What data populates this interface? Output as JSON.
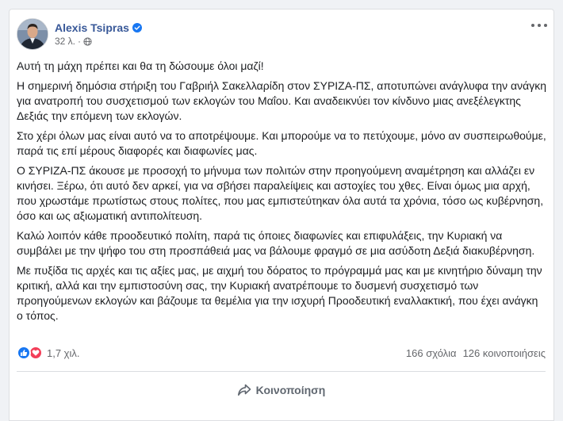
{
  "colors": {
    "page_bg": "#f0f2f5",
    "author_name": "#385898",
    "verified_badge": "#1877f2",
    "like_reaction": "#1877f2",
    "love_reaction": "#f33e58",
    "secondary_text": "#65676b"
  },
  "post": {
    "author": "Alexis Tsipras",
    "verified_icon": "verified-badge-icon",
    "timestamp": "32 λ.",
    "separator": "·",
    "audience_icon": "globe-icon",
    "more_icon": "more-options-icon",
    "paragraphs": [
      "Αυτή τη μάχη πρέπει και θα τη δώσουμε όλοι μαζί!",
      "Η σημερινή δημόσια στήριξη του Γαβριήλ Σακελλαρίδη στον ΣΥΡΙΖΑ-ΠΣ, αποτυπώνει ανάγλυφα την ανάγκη για ανατροπή του συσχετισμού των εκλογών του Μαΐου. Και αναδεικνύει τον κίνδυνο μιας ανεξέλεγκτης Δεξιάς την επόμενη των εκλογών.",
      "Στο χέρι όλων μας είναι αυτό να το αποτρέψουμε. Και μπορούμε να το πετύχουμε, μόνο αν συσπειρωθούμε, παρά τις επί μέρους διαφορές και διαφωνίες μας.",
      "Ο ΣΥΡΙΖΑ-ΠΣ άκουσε με προσοχή το μήνυμα των πολιτών στην προηγούμενη αναμέτρηση και αλλάζει εν κινήσει. Ξέρω, ότι αυτό δεν αρκεί, για να σβήσει παραλείψεις και αστοχίες του χθες. Είναι όμως μια αρχή, που χρωστάμε πρωτίστως στους πολίτες, που μας εμπιστεύτηκαν όλα αυτά τα χρόνια, τόσο ως κυβέρνηση, όσο και ως αξιωματική αντιπολίτευση.",
      "Καλώ λοιπόν κάθε προοδευτικό πολίτη, παρά τις όποιες διαφωνίες και επιφυλάξεις, την Κυριακή να συμβάλει με την ψήφο του στη προσπάθειά μας να βάλουμε φραγμό σε μια ασύδοτη Δεξιά διακυβέρνηση.",
      "Με πυξίδα τις αρχές και τις αξίες μας, με αιχμή του δόρατος το πρόγραμμά μας και με κινητήριο δύναμη την κριτική, αλλά και την εμπιστοσύνη σας, την Κυριακή ανατρέπουμε το δυσμενή συσχετισμό των προηγούμενων εκλογών και βάζουμε τα θεμέλια για την ισχυρή Προοδευτική εναλλακτική, που έχει ανάγκη ο τόπος."
    ]
  },
  "stats": {
    "reaction_icons": [
      "like-icon",
      "love-icon"
    ],
    "reactions": "1,7 χιλ.",
    "comments": "166 σχόλια",
    "shares": "126 κοινοποιήσεις"
  },
  "actions": {
    "share_label": "Κοινοποίηση",
    "share_icon": "share-arrow-icon"
  }
}
